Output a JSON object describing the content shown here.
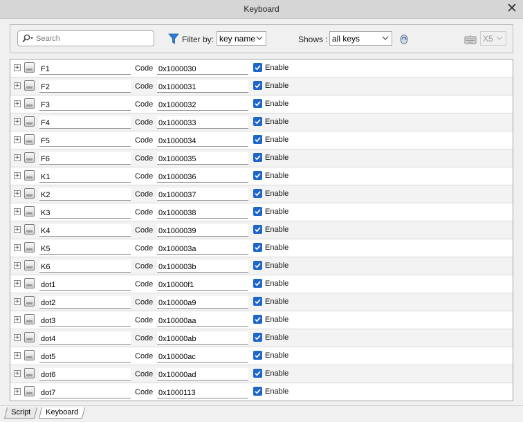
{
  "window": {
    "title": "Keyboard",
    "close_glyph": "✕"
  },
  "toolbar": {
    "search_placeholder": "Search",
    "filter_label": "Filter by:",
    "filter_value": "key name",
    "shows_label": "Shows :",
    "shows_value": "all keys",
    "device_value": "X5",
    "icons": {
      "search": "search-icon",
      "filter": "filter-icon",
      "refresh": "refresh-icon",
      "keyboard": "keyboard-icon"
    }
  },
  "row_labels": {
    "code": "Code",
    "enable": "Enable"
  },
  "keys": [
    {
      "name": "F1",
      "code": "0x1000030",
      "enabled": true
    },
    {
      "name": "F2",
      "code": "0x1000031",
      "enabled": true
    },
    {
      "name": "F3",
      "code": "0x1000032",
      "enabled": true
    },
    {
      "name": "F4",
      "code": "0x1000033",
      "enabled": true
    },
    {
      "name": "F5",
      "code": "0x1000034",
      "enabled": true
    },
    {
      "name": "F6",
      "code": "0x1000035",
      "enabled": true
    },
    {
      "name": "K1",
      "code": "0x1000036",
      "enabled": true
    },
    {
      "name": "K2",
      "code": "0x1000037",
      "enabled": true
    },
    {
      "name": "K3",
      "code": "0x1000038",
      "enabled": true
    },
    {
      "name": "K4",
      "code": "0x1000039",
      "enabled": true
    },
    {
      "name": "K5",
      "code": "0x100003a",
      "enabled": true
    },
    {
      "name": "K6",
      "code": "0x100003b",
      "enabled": true
    },
    {
      "name": "dot1",
      "code": "0x10000f1",
      "enabled": true
    },
    {
      "name": "dot2",
      "code": "0x10000a9",
      "enabled": true
    },
    {
      "name": "dot3",
      "code": "0x10000aa",
      "enabled": true
    },
    {
      "name": "dot4",
      "code": "0x10000ab",
      "enabled": true
    },
    {
      "name": "dot5",
      "code": "0x10000ac",
      "enabled": true
    },
    {
      "name": "dot6",
      "code": "0x10000ad",
      "enabled": true
    },
    {
      "name": "dot7",
      "code": "0x1000113",
      "enabled": true
    }
  ],
  "tabs": [
    {
      "label": "Script",
      "active": false
    },
    {
      "label": "Keyboard",
      "active": true
    }
  ],
  "colors": {
    "checkbox": "#1f66c9",
    "filter_icon": "#2a7fd4",
    "title_bar": "#d6d6d6"
  }
}
